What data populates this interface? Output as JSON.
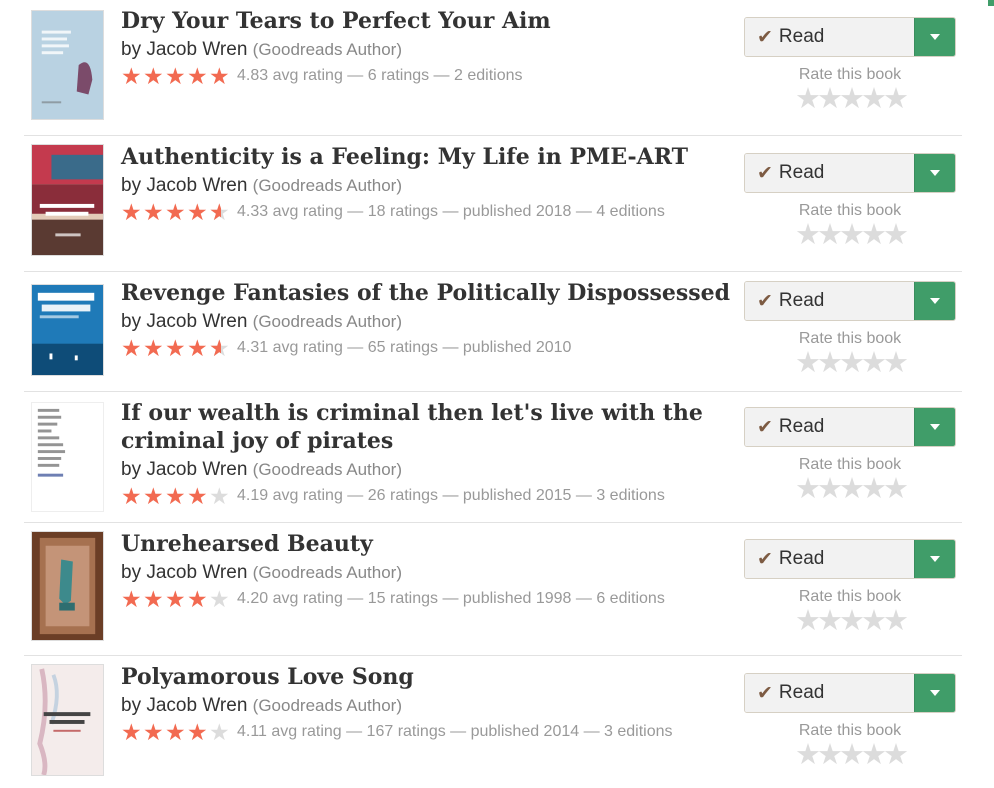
{
  "books": [
    {
      "title": "Dry Your Tears to Perfect Your Aim",
      "by": "by",
      "author": "Jacob Wren",
      "author_role": "(Goodreads Author)",
      "stars": 4.83,
      "rating_text": "4.83 avg rating — 6 ratings — 2 editions",
      "button_label": "Read",
      "rate_label": "Rate this book",
      "cover_colors": [
        "#aac6d8",
        "#7b4b6a"
      ]
    },
    {
      "title": "Authenticity is a Feeling: My Life in PME-ART",
      "by": "by",
      "author": "Jacob Wren",
      "author_role": "(Goodreads Author)",
      "stars": 4.33,
      "rating_text": "4.33 avg rating — 18 ratings — published 2018 — 4 editions",
      "button_label": "Read",
      "rate_label": "Rate this book",
      "cover_colors": [
        "#c43a4e",
        "#3a6b8a"
      ]
    },
    {
      "title": "Revenge Fantasies of the Politically Dispossessed",
      "by": "by",
      "author": "Jacob Wren",
      "author_role": "(Goodreads Author)",
      "stars": 4.31,
      "rating_text": "4.31 avg rating — 65 ratings — published 2010",
      "button_label": "Read",
      "rate_label": "Rate this book",
      "cover_colors": [
        "#1f7ab8",
        "#0e4c78"
      ]
    },
    {
      "title": "If our wealth is criminal then let's live with the criminal joy of pirates",
      "by": "by",
      "author": "Jacob Wren",
      "author_role": "(Goodreads Author)",
      "stars": 4.19,
      "rating_text": "4.19 avg rating — 26 ratings — published 2015 — 3 editions",
      "button_label": "Read",
      "rate_label": "Rate this book",
      "cover_colors": [
        "#ffffff",
        "#4a5fa0"
      ]
    },
    {
      "title": "Unrehearsed Beauty",
      "by": "by",
      "author": "Jacob Wren",
      "author_role": "(Goodreads Author)",
      "stars": 4.2,
      "rating_text": "4.20 avg rating — 15 ratings — published 1998 — 6 editions",
      "button_label": "Read",
      "rate_label": "Rate this book",
      "cover_colors": [
        "#8a5a3c",
        "#3d8a8c"
      ]
    },
    {
      "title": "Polyamorous Love Song",
      "by": "by",
      "author": "Jacob Wren",
      "author_role": "(Goodreads Author)",
      "stars": 4.11,
      "rating_text": "4.11 avg rating — 167 ratings — published 2014 — 3 editions",
      "button_label": "Read",
      "rate_label": "Rate this book",
      "cover_colors": [
        "#f4eceb",
        "#b94a4a"
      ]
    }
  ],
  "colors": {
    "accent_green": "#409d69",
    "star_filled": "#f26a51",
    "star_empty": "#dcdcdc",
    "check_brown": "#7d5b43"
  }
}
